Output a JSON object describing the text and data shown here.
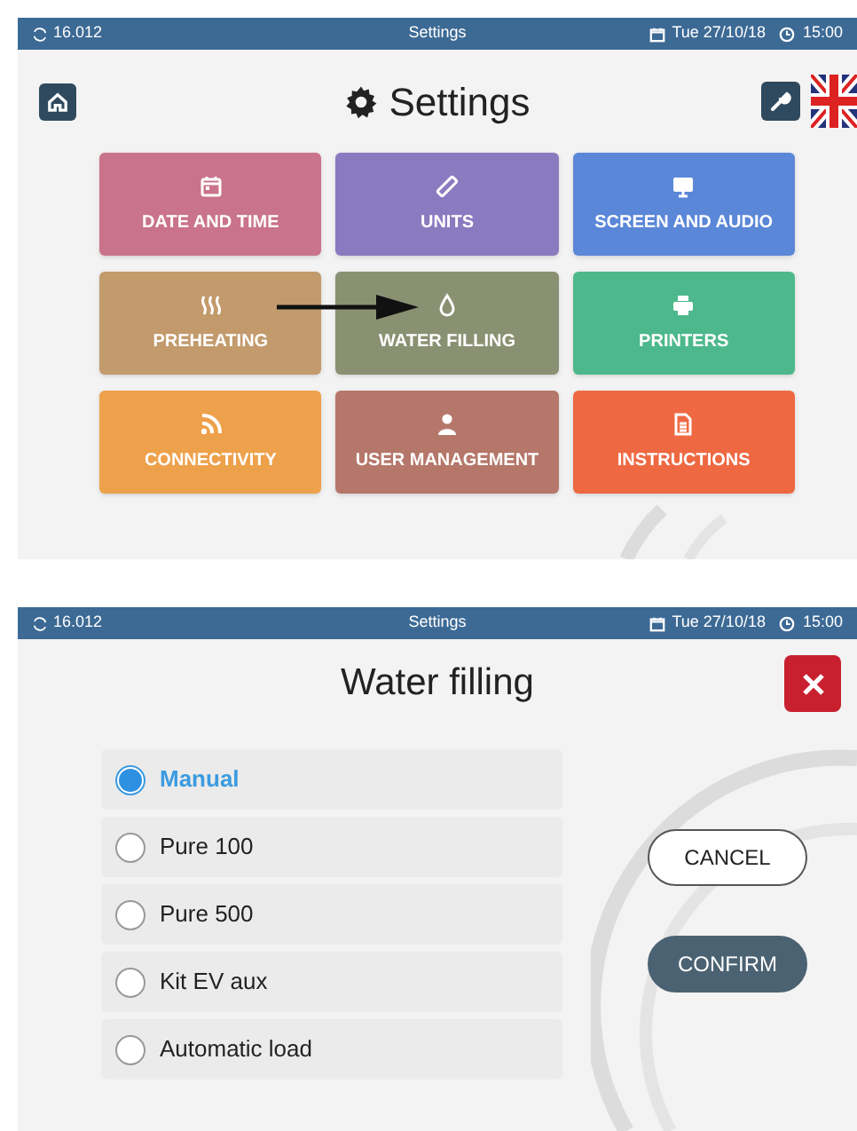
{
  "settings_screen": {
    "status_bar": {
      "version": "16.012",
      "title": "Settings",
      "date": "Tue 27/10/18",
      "time": "15:00"
    },
    "title": "Settings",
    "tiles": [
      {
        "label": "DATE AND TIME",
        "color": "#c9738c"
      },
      {
        "label": "UNITS",
        "color": "#8a7bc0"
      },
      {
        "label": "SCREEN AND AUDIO",
        "color": "#5a87d8"
      },
      {
        "label": "PREHEATING",
        "color": "#c29a6c"
      },
      {
        "label": "WATER FILLING",
        "color": "#8a9173"
      },
      {
        "label": "PRINTERS",
        "color": "#4db88b"
      },
      {
        "label": "CONNECTIVITY",
        "color": "#eea14b"
      },
      {
        "label": "USER MANAGEMENT",
        "color": "#b5776a"
      },
      {
        "label": "INSTRUCTIONS",
        "color": "#ee6942"
      }
    ]
  },
  "water_filling_screen": {
    "status_bar": {
      "version": "16.012",
      "title": "Settings",
      "date": "Tue 27/10/18",
      "time": "15:00"
    },
    "title": "Water filling",
    "options": [
      {
        "label": "Manual",
        "selected": true
      },
      {
        "label": "Pure 100",
        "selected": false
      },
      {
        "label": "Pure 500",
        "selected": false
      },
      {
        "label": "Kit EV aux",
        "selected": false
      },
      {
        "label": "Automatic load",
        "selected": false
      }
    ],
    "buttons": [
      {
        "label": "CANCEL",
        "kind": "outline"
      },
      {
        "label": "CONFIRM",
        "kind": "filled"
      }
    ]
  }
}
